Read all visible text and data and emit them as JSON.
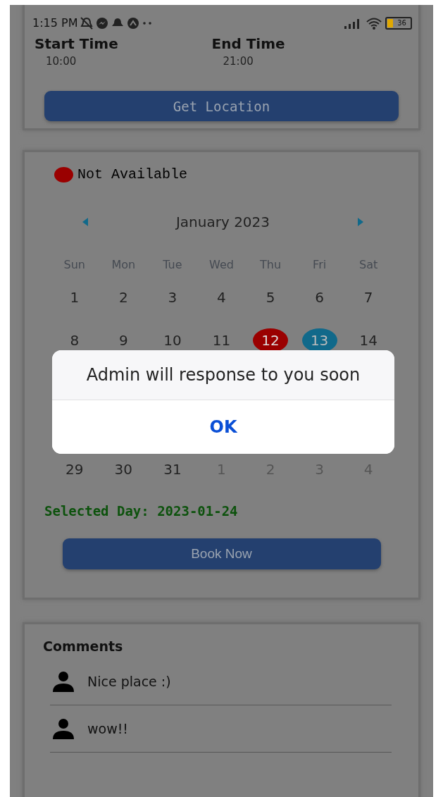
{
  "status_bar": {
    "time": "1:15 PM",
    "battery": "36"
  },
  "times": [
    {
      "label": "Start Time",
      "value": "10:00"
    },
    {
      "label": "End Time",
      "value": "21:00"
    }
  ],
  "location_button": "Get Location",
  "legend": {
    "label": "Not Available",
    "color": "#9a0000"
  },
  "calendar": {
    "month": "January 2023",
    "weekdays": [
      "Sun",
      "Mon",
      "Tue",
      "Wed",
      "Thu",
      "Fri",
      "Sat"
    ],
    "weeks": [
      [
        {
          "day": "1",
          "kind": "normal"
        },
        {
          "day": "2",
          "kind": "normal"
        },
        {
          "day": "3",
          "kind": "normal"
        },
        {
          "day": "4",
          "kind": "normal"
        },
        {
          "day": "5",
          "kind": "normal"
        },
        {
          "day": "6",
          "kind": "normal"
        },
        {
          "day": "7",
          "kind": "normal"
        }
      ],
      [
        {
          "day": "8",
          "kind": "normal"
        },
        {
          "day": "9",
          "kind": "normal"
        },
        {
          "day": "10",
          "kind": "normal"
        },
        {
          "day": "11",
          "kind": "normal"
        },
        {
          "day": "12",
          "kind": "unavailable"
        },
        {
          "day": "13",
          "kind": "today"
        },
        {
          "day": "14",
          "kind": "normal"
        }
      ],
      [
        {
          "day": "29",
          "kind": "normal"
        },
        {
          "day": "30",
          "kind": "normal"
        },
        {
          "day": "31",
          "kind": "normal"
        },
        {
          "day": "1",
          "kind": "outside"
        },
        {
          "day": "2",
          "kind": "outside"
        },
        {
          "day": "3",
          "kind": "outside"
        },
        {
          "day": "4",
          "kind": "outside"
        }
      ]
    ]
  },
  "selected_day": "Selected Day: 2023-01-24",
  "book_button": "Book Now",
  "comments": {
    "title": "Comments",
    "items": [
      {
        "text": "Nice place :)"
      },
      {
        "text": "wow!!"
      }
    ]
  },
  "dialog": {
    "message": "Admin will response to you soon",
    "button": "OK"
  }
}
